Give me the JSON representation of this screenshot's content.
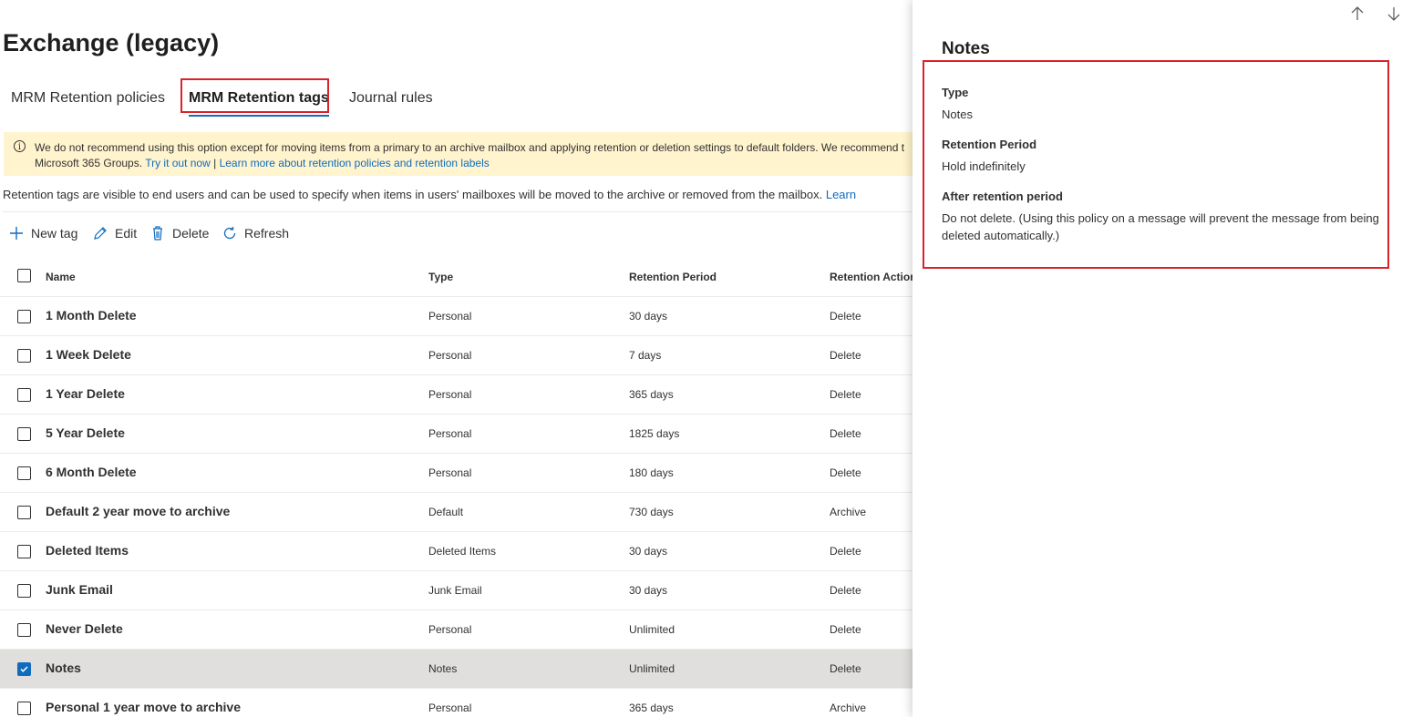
{
  "page": {
    "title": "Exchange (legacy)"
  },
  "tabs": [
    {
      "label": "MRM Retention policies",
      "active": false
    },
    {
      "label": "MRM Retention tags",
      "active": true
    },
    {
      "label": "Journal rules",
      "active": false
    }
  ],
  "banner": {
    "line1": "We do not recommend using this option except for moving items from a primary to an archive mailbox and applying retention or deletion settings to default folders. We recommend t",
    "line2_prefix": "Microsoft 365 Groups.",
    "link1": "Try it out now",
    "divider": "|",
    "link2": "Learn more about retention policies and retention labels"
  },
  "description": {
    "text": "Retention tags are visible to end users and can be used to specify when items in users' mailboxes will be moved to the archive or removed from the mailbox.",
    "link": "Learn"
  },
  "toolbar": {
    "new_tag": "New tag",
    "edit": "Edit",
    "delete": "Delete",
    "refresh": "Refresh"
  },
  "table": {
    "headers": {
      "name": "Name",
      "type": "Type",
      "period": "Retention Period",
      "action": "Retention Action"
    },
    "rows": [
      {
        "name": "1 Month Delete",
        "type": "Personal",
        "period": "30 days",
        "action": "Delete",
        "selected": false
      },
      {
        "name": "1 Week Delete",
        "type": "Personal",
        "period": "7 days",
        "action": "Delete",
        "selected": false
      },
      {
        "name": "1 Year Delete",
        "type": "Personal",
        "period": "365 days",
        "action": "Delete",
        "selected": false
      },
      {
        "name": "5 Year Delete",
        "type": "Personal",
        "period": "1825 days",
        "action": "Delete",
        "selected": false
      },
      {
        "name": "6 Month Delete",
        "type": "Personal",
        "period": "180 days",
        "action": "Delete",
        "selected": false
      },
      {
        "name": "Default 2 year move to archive",
        "type": "Default",
        "period": "730 days",
        "action": "Archive",
        "selected": false
      },
      {
        "name": "Deleted Items",
        "type": "Deleted Items",
        "period": "30 days",
        "action": "Delete",
        "selected": false
      },
      {
        "name": "Junk Email",
        "type": "Junk Email",
        "period": "30 days",
        "action": "Delete",
        "selected": false
      },
      {
        "name": "Never Delete",
        "type": "Personal",
        "period": "Unlimited",
        "action": "Delete",
        "selected": false
      },
      {
        "name": "Notes",
        "type": "Notes",
        "period": "Unlimited",
        "action": "Delete",
        "selected": true
      },
      {
        "name": "Personal 1 year move to archive",
        "type": "Personal",
        "period": "365 days",
        "action": "Archive",
        "selected": false
      }
    ]
  },
  "details_panel": {
    "title": "Notes",
    "type_label": "Type",
    "type_value": "Notes",
    "period_label": "Retention Period",
    "period_value": "Hold indefinitely",
    "after_label": "After retention period",
    "after_value": "Do not delete. (Using this policy on a message will prevent the message from being deleted automatically.)",
    "nav": {
      "up_icon": "arrow-up-icon",
      "down_icon": "arrow-down-icon"
    }
  },
  "colors": {
    "accent": "#0f6cbd",
    "highlight": "#d9222a",
    "banner": "#fff4ce",
    "selected_row": "#e1dfdd"
  }
}
